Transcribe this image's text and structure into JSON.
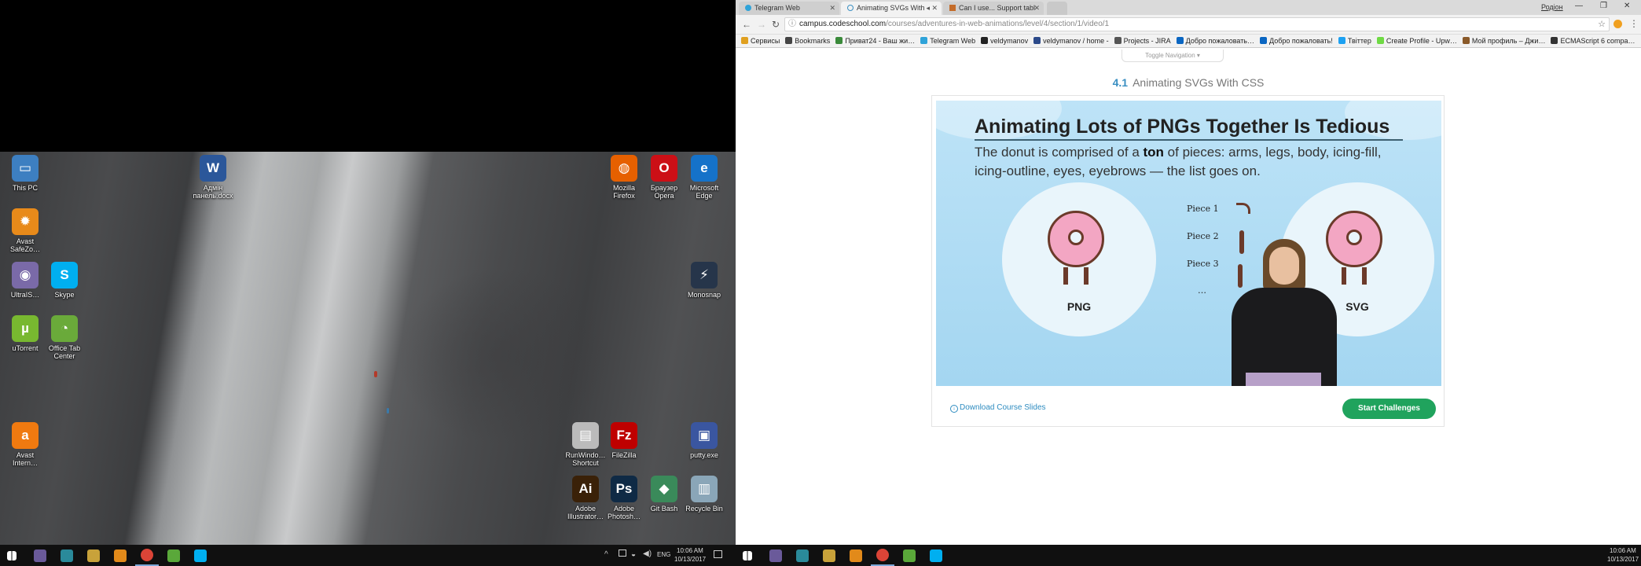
{
  "desktop": {
    "icons": [
      {
        "name": "this-pc",
        "label": "This PC",
        "color": "#3d7fc1",
        "glyph": "▭"
      },
      {
        "name": "avast-safezone",
        "label": "Avast SafeZo…",
        "color": "#e88a1a",
        "glyph": "✹"
      },
      {
        "name": "ultraiso",
        "label": "UltraIS…",
        "color": "#7a6aa8",
        "glyph": "◉"
      },
      {
        "name": "skype",
        "label": "Skype",
        "color": "#00aff0",
        "glyph": "S"
      },
      {
        "name": "utorrent",
        "label": "uTorrent",
        "color": "#78b830",
        "glyph": "µ"
      },
      {
        "name": "office-tab-center",
        "label": "Office Tab Center",
        "color": "#6aaa3a",
        "glyph": "◔"
      },
      {
        "name": "avast-internet",
        "label": "Avast Intern…",
        "color": "#f07a10",
        "glyph": "a"
      },
      {
        "name": "word-doc",
        "label": "Адмін панель.docx",
        "color": "#2b579a",
        "glyph": "W"
      },
      {
        "name": "mozilla-firefox",
        "label": "Mozilla Firefox",
        "color": "#e66000",
        "glyph": "◍"
      },
      {
        "name": "opera",
        "label": "Браузер Opera",
        "color": "#cc0f16",
        "glyph": "O"
      },
      {
        "name": "microsoft-edge",
        "label": "Microsoft Edge",
        "color": "#1572c9",
        "glyph": "e"
      },
      {
        "name": "monosnap",
        "label": "Monosnap",
        "color": "#26354a",
        "glyph": "⚡"
      },
      {
        "name": "runwindow-shortcut",
        "label": "RunWindo… Shortcut",
        "color": "#bbbbbb",
        "glyph": "▤"
      },
      {
        "name": "filezilla",
        "label": "FileZilla",
        "color": "#bf0000",
        "glyph": "Fz"
      },
      {
        "name": "putty",
        "label": "putty.exe",
        "color": "#3a56a0",
        "glyph": "▣"
      },
      {
        "name": "adobe-illustrator",
        "label": "Adobe Illustrator…",
        "color": "#3a2108",
        "glyph": "Ai"
      },
      {
        "name": "adobe-photoshop",
        "label": "Adobe Photosh…",
        "color": "#0f2a45",
        "glyph": "Ps"
      },
      {
        "name": "git-bash",
        "label": "Git Bash",
        "color": "#3a8a5a",
        "glyph": "◆"
      },
      {
        "name": "recycle-bin",
        "label": "Recycle Bin",
        "color": "#8aa6b8",
        "glyph": "▥"
      }
    ]
  },
  "taskbar_left": {
    "lang": "ENG",
    "time": "10:06 AM",
    "date": "10/13/2017",
    "icon_colors": [
      "#6a5a9a",
      "#2a8a9a",
      "#c8a23a",
      "#e28a1a",
      "#db4437",
      "#5aa83a",
      "#00aff0"
    ]
  },
  "taskbar_right": {
    "time": "10:06 AM",
    "date": "10/13/2017",
    "icon_colors": [
      "#6a5a9a",
      "#2a8a9a",
      "#c8a23a",
      "#e28a1a",
      "#db4437",
      "#5aa83a",
      "#00aff0"
    ]
  },
  "browser": {
    "profile": "Родіон",
    "tabs": [
      {
        "label": "Telegram Web",
        "active": false
      },
      {
        "label": "Animating SVGs With",
        "active": true
      },
      {
        "label": "Can I use... Support tabl",
        "active": false
      }
    ],
    "url_host": "campus.codeschool.com",
    "url_path": "/courses/adventures-in-web-animations/level/4/section/1/video/1",
    "bookmarks": [
      {
        "label": "Сервисы",
        "color": "#e0a020"
      },
      {
        "label": "Bookmarks",
        "color": "#444"
      },
      {
        "label": "Приват24 - Ваш жи…",
        "color": "#3a8a3a"
      },
      {
        "label": "Telegram Web",
        "color": "#2fa3d9"
      },
      {
        "label": "veldymanov",
        "color": "#222"
      },
      {
        "label": "veldymanov / home -",
        "color": "#2c4a8a"
      },
      {
        "label": "Projects - JIRA",
        "color": "#555"
      },
      {
        "label": "Добро пожаловать…",
        "color": "#0a66c2"
      },
      {
        "label": "Добро пожаловать!",
        "color": "#0a66c2"
      },
      {
        "label": "Твіттер",
        "color": "#1da1f2"
      },
      {
        "label": "Create Profile - Upw…",
        "color": "#6fda44"
      },
      {
        "label": "Мой профиль – Джи…",
        "color": "#8a5a2a"
      },
      {
        "label": "ECMAScript 6 compa…",
        "color": "#333"
      }
    ]
  },
  "page": {
    "toggle_nav": "Toggle Navigation ▾",
    "lesson_number": "4.1",
    "lesson_title": "Animating SVGs With CSS",
    "slide": {
      "title": "Animating Lots of PNGs Together Is Tedious",
      "body_pre": "The donut is comprised of a ",
      "body_bold": "ton",
      "body_post": " of pieces: arms, legs, body, icing-fill, icing-outline, eyes, eyebrows — the list goes on.",
      "png_label": "PNG",
      "svg_label": "SVG",
      "pieces": [
        "Piece 1",
        "Piece 2",
        "Piece 3",
        "…"
      ]
    },
    "download_label": "Download Course Slides",
    "start_label": "Start Challenges"
  }
}
